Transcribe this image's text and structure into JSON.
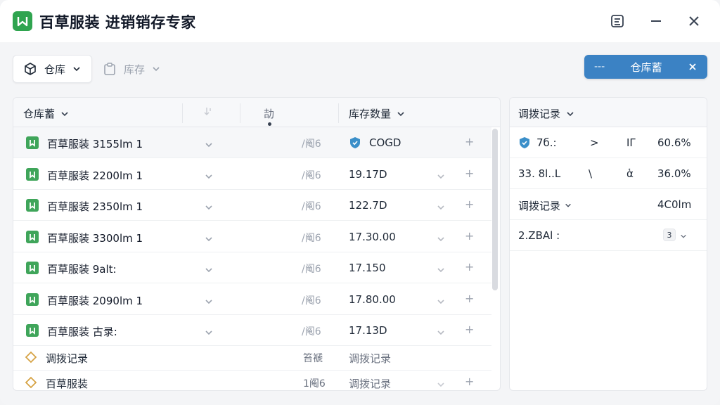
{
  "app": {
    "title": "百草服装 进销销存专家",
    "brand_color": "#2fa44f"
  },
  "toolbar": {
    "warehouse_label": "仓库",
    "stock_label": "库存",
    "primary_button": {
      "prefix": "---",
      "label": "仓库蓄"
    }
  },
  "table": {
    "headers": {
      "col1": "仓库蓄",
      "col3": "劼",
      "col4": "库存数量"
    },
    "rows": [
      {
        "name": "百草服装 3155lm 1",
        "unit": "/阄6",
        "qty": "COGD",
        "qty_has_icon": true,
        "selected": true
      },
      {
        "name": "百草服装 2200lm 1",
        "unit": "/阄6",
        "qty": "19.17D",
        "qty_has_icon": false
      },
      {
        "name": "百草服装 2350lm 1",
        "unit": "/阄6",
        "qty": "122.7D",
        "qty_has_icon": false
      },
      {
        "name": "百草服装 3300lm 1",
        "unit": "/阄6",
        "qty": "17.30.00",
        "qty_has_icon": false
      },
      {
        "name": "百草服装 9alt:",
        "unit": "/阄6",
        "qty": "17.150",
        "qty_has_icon": false
      },
      {
        "name": "百草服装 2090lm 1",
        "unit": "/阄6",
        "qty": "17.80.00",
        "qty_has_icon": false
      },
      {
        "name": "百草服装 古录:",
        "unit": "/阄6",
        "qty": "17.13D",
        "qty_has_icon": false
      }
    ],
    "category_rows": [
      {
        "name": "调拨记录",
        "unit": "笞褫",
        "qty": "调拨记录"
      },
      {
        "name": "百草服装",
        "unit": "1阄6",
        "qty": "调拨记录"
      }
    ]
  },
  "side": {
    "header": "调拨记录",
    "rows": [
      {
        "a": "7б.:",
        "b": ">",
        "c": "ΙΓ",
        "d": "60.6%"
      },
      {
        "a": "33. 8l..L",
        "b": "\\",
        "c": "ἁ",
        "d": "36.0%"
      },
      {
        "a": "调拨记录",
        "d": "4C0lm"
      },
      {
        "a": "2.ZBAl :"
      }
    ]
  }
}
